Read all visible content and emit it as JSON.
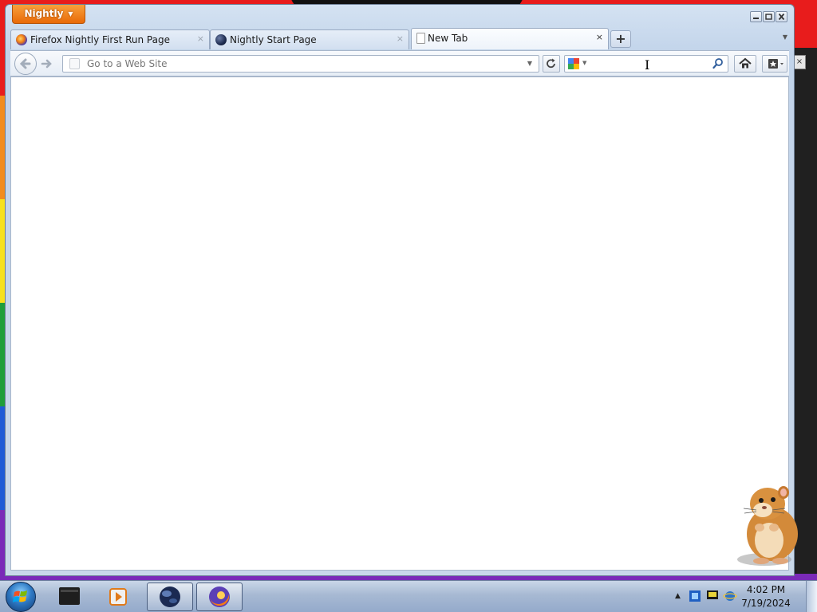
{
  "app": {
    "menu_label": "Nightly"
  },
  "tabs": [
    {
      "label": "Firefox Nightly First Run Page",
      "icon": "firefox-icon",
      "selected": false
    },
    {
      "label": "Nightly Start Page",
      "icon": "nightly-globe-icon",
      "selected": false
    },
    {
      "label": "New Tab",
      "icon": "blank-page-icon",
      "selected": true
    }
  ],
  "tab_close_glyph": "×",
  "newtab_glyph": "+",
  "navbar": {
    "url_placeholder": "Go to a Web Site",
    "url_value": "",
    "search_value": ""
  },
  "taskbar": {
    "time": "4:02 PM",
    "date": "7/19/2024"
  },
  "colors": {
    "app_button": "#e86a08",
    "window_frame": "#c2d4ea"
  }
}
